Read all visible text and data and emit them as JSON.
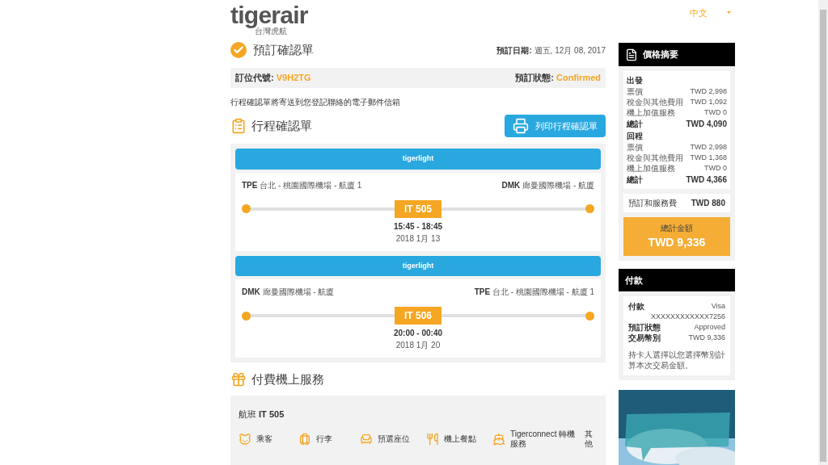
{
  "header": {
    "logo": "tigerair",
    "logo_sub": "台灣虎航",
    "language": "中文"
  },
  "confirmation": {
    "title": "預訂確認單",
    "date_label": "預訂日期:",
    "date": "週五, 12月 08, 2017",
    "code_label": "訂位代號:",
    "code": "V9H2TG",
    "status_label": "預訂狀態:",
    "status": "Confirmed",
    "note": "行程確認單將寄送到您登記聯絡的電子郵件信箱"
  },
  "itinerary": {
    "title": "行程確認單",
    "print_button": "列印行程確認單",
    "flights": [
      {
        "fare": "tigerlight",
        "from_code": "TPE",
        "from_name": "台北 - 桃園國際機場 - 航廈 1",
        "to_code": "DMK",
        "to_name": "廊曼國際機場 - 航廈",
        "flight": "IT 505",
        "times": "15:45 - 18:45",
        "date": "2018 1月 13"
      },
      {
        "fare": "tigerlight",
        "from_code": "DMK",
        "from_name": "廊曼國際機場 - 航廈",
        "to_code": "TPE",
        "to_name": "台北 - 桃園國際機場 - 航廈 1",
        "flight": "IT 506",
        "times": "20:00 - 00:40",
        "date": "2018 1月 20"
      }
    ]
  },
  "services": {
    "title": "付費機上服務",
    "flight_label": "航班",
    "flight": "IT 505",
    "categories": [
      {
        "kind": "passenger",
        "label": "乘客"
      },
      {
        "kind": "baggage",
        "label": "行李"
      },
      {
        "kind": "seat",
        "label": "預選座位"
      },
      {
        "kind": "meal",
        "label": "機上餐點"
      },
      {
        "kind": "connect",
        "label": "Tigerconnect 轉機服務"
      },
      {
        "kind": "other",
        "label": "其他"
      }
    ]
  },
  "price_summary": {
    "title": "價格摘要",
    "sections": [
      {
        "heading": "出發",
        "lines": [
          {
            "label": "票價",
            "value": "TWD 2,998"
          },
          {
            "label": "稅金與其他費用",
            "value": "TWD 1,092"
          },
          {
            "label": "機上加值服務",
            "value": "TWD 0"
          }
        ],
        "total_label": "總計",
        "total": "TWD 4,090"
      },
      {
        "heading": "回程",
        "lines": [
          {
            "label": "票價",
            "value": "TWD 2,998"
          },
          {
            "label": "稅金與其他費用",
            "value": "TWD 1,368"
          },
          {
            "label": "機上加值服務",
            "value": "TWD 0"
          }
        ],
        "total_label": "總計",
        "total": "TWD 4,366"
      }
    ],
    "fee_label": "預訂和服務費",
    "fee": "TWD 880",
    "grand_total_label": "總計金額",
    "grand_total": "TWD 9,336"
  },
  "payment": {
    "title": "付款",
    "rows": [
      {
        "label": "付款",
        "value": "Visa"
      },
      {
        "value": "XXXXXXXXXXXX7256"
      },
      {
        "label": "預訂狀態",
        "value": "Approved"
      },
      {
        "label": "交易幣別",
        "value": "TWD 9,336"
      }
    ],
    "note": "持卡人選擇以您選擇幣別計算本次交易金額。"
  }
}
